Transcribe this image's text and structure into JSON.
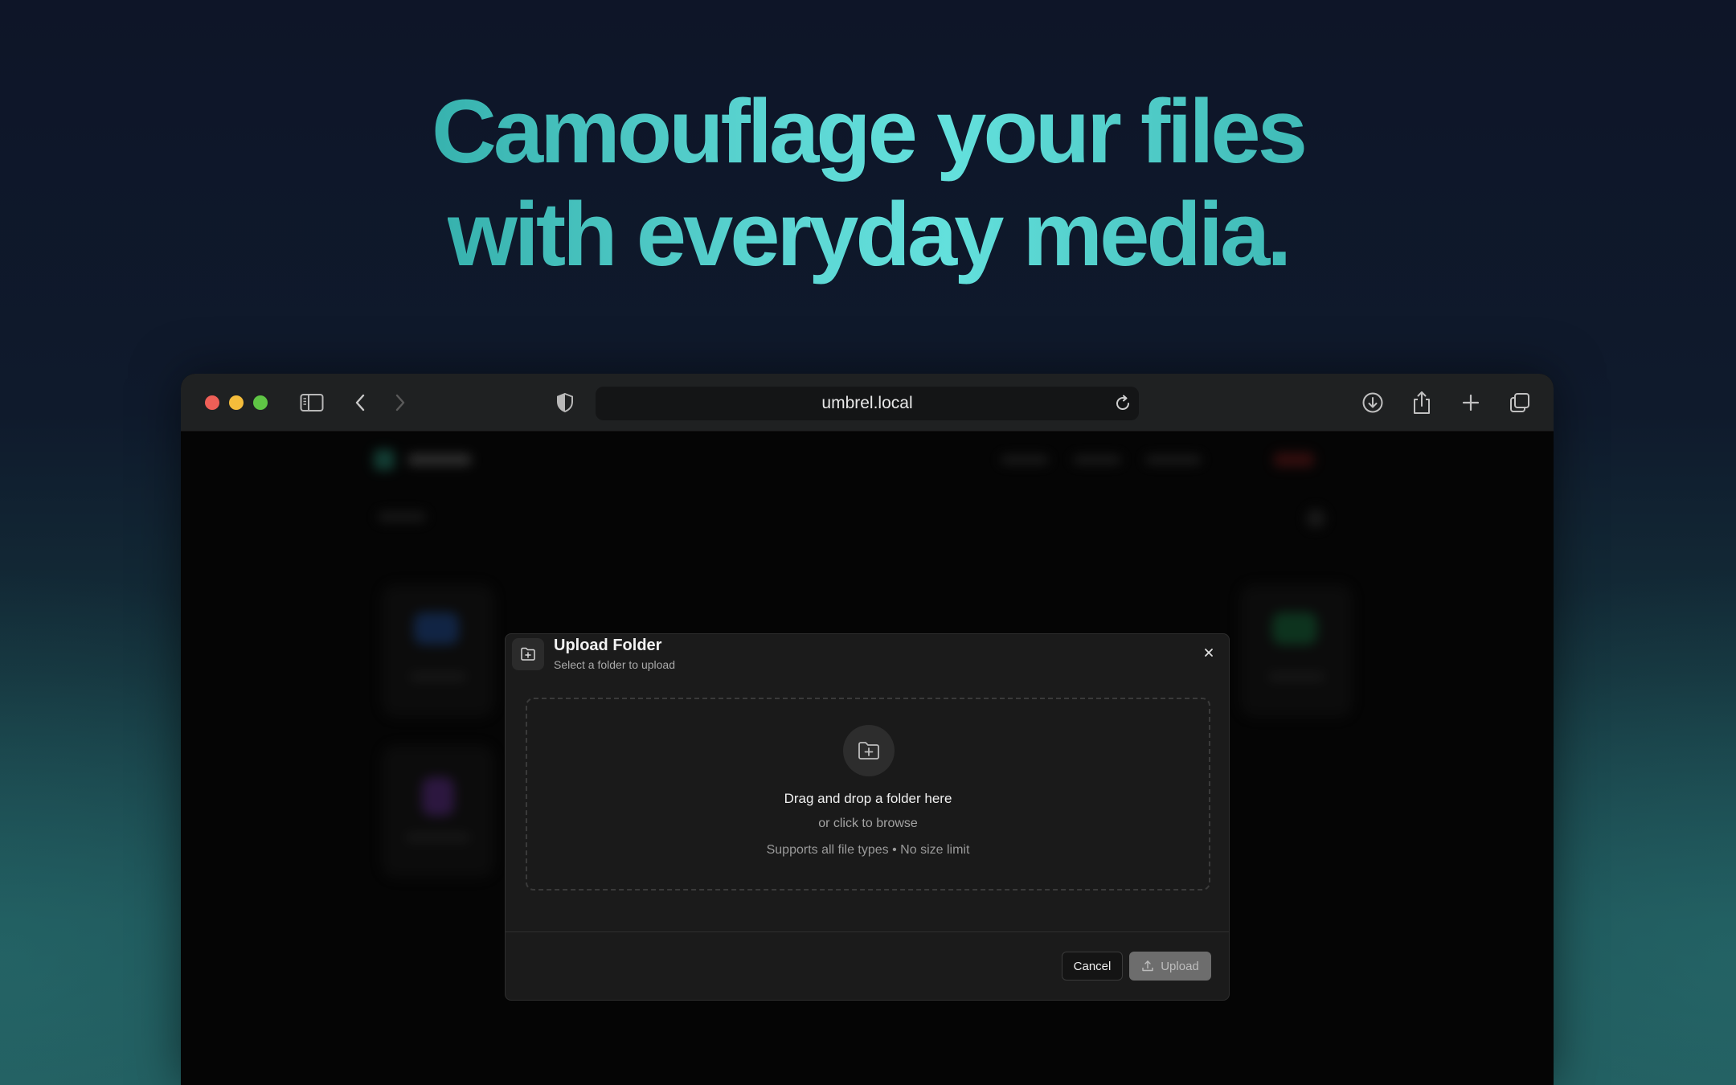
{
  "hero": {
    "headline_line1": "Camouflage your files",
    "headline_line2": "with everyday media."
  },
  "browser": {
    "url": "umbrel.local",
    "icons": [
      "sidebar-icon",
      "back-icon",
      "forward-icon",
      "shield-icon",
      "reload-icon",
      "download-icon",
      "share-icon",
      "plus-icon",
      "tabs-icon"
    ]
  },
  "modal": {
    "title": "Upload Folder",
    "subtitle": "Select a folder to upload",
    "dropzone": {
      "main": "Drag and drop a folder here",
      "secondary": "or click to browse",
      "hint": "Supports all file types • No size limit"
    },
    "cancel_label": "Cancel",
    "upload_label": "Upload"
  },
  "colors": {
    "headline_accent": "#5cd6d3",
    "modal_bg": "#1b1b1b",
    "upload_disabled": "#6d6d6d"
  }
}
